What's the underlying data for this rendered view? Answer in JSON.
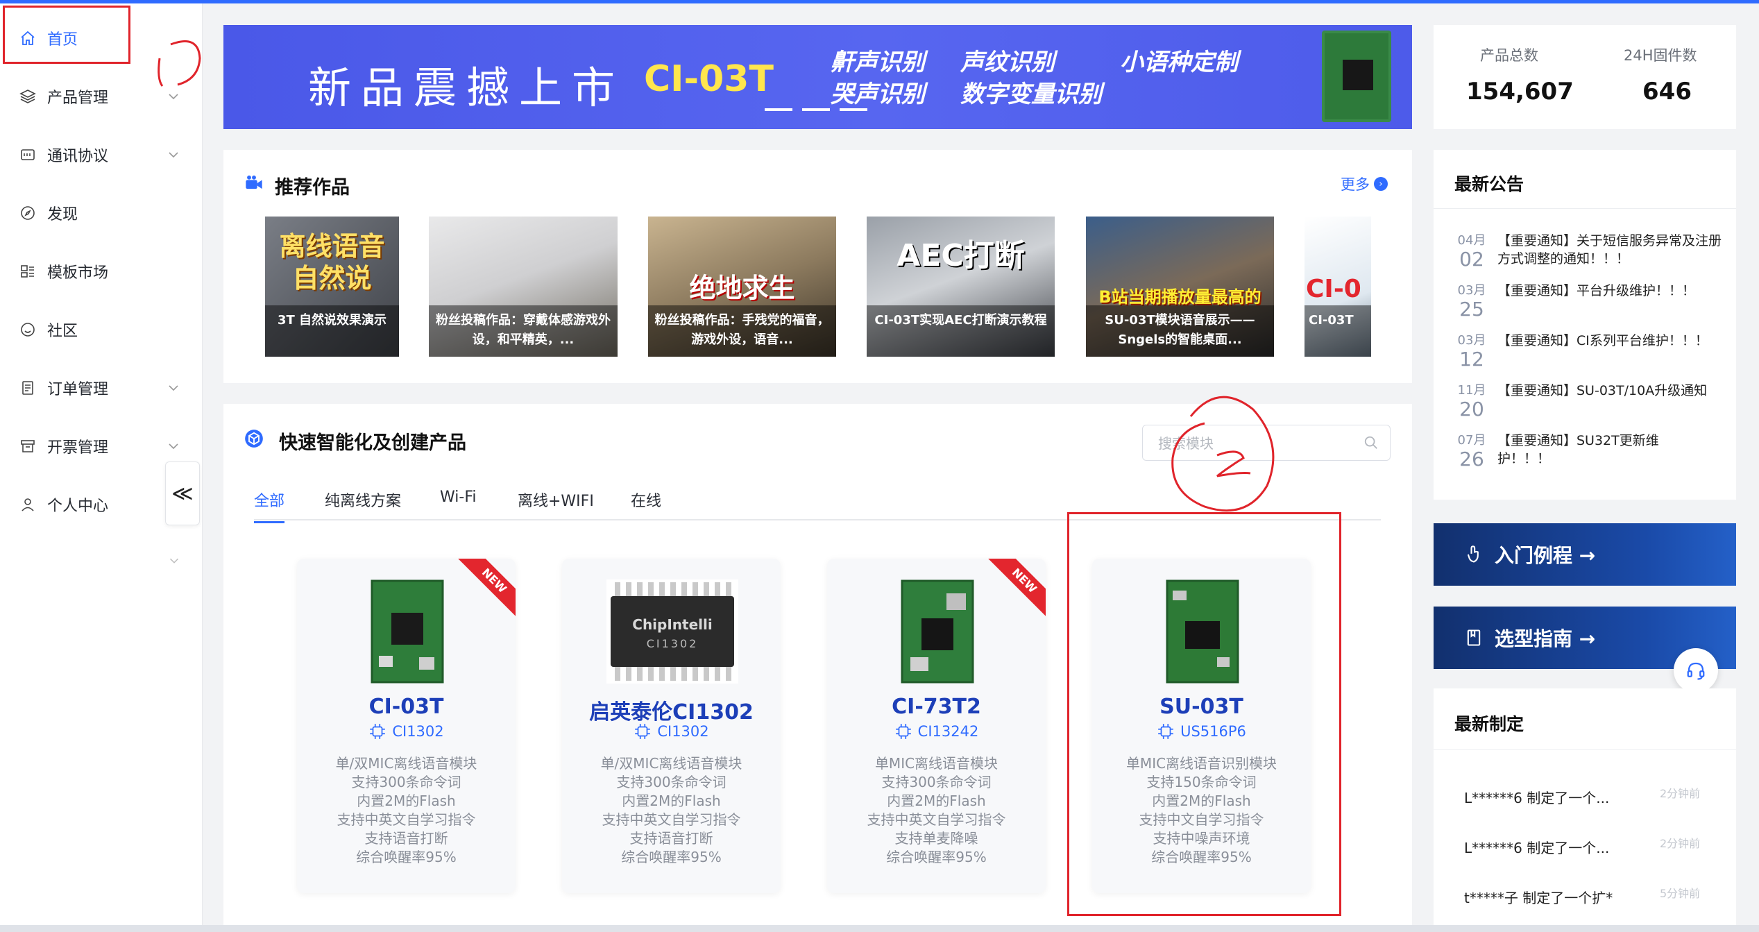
{
  "sidebar": {
    "items": [
      {
        "label": "首页",
        "icon": "home-icon",
        "active": true
      },
      {
        "label": "产品管理",
        "icon": "layers-icon"
      },
      {
        "label": "通讯协议",
        "icon": "protocol-icon"
      },
      {
        "label": "发现",
        "icon": "compass-icon"
      },
      {
        "label": "模板市场",
        "icon": "template-icon"
      },
      {
        "label": "社区",
        "icon": "smile-icon"
      },
      {
        "label": "订单管理",
        "icon": "order-icon"
      },
      {
        "label": "开票管理",
        "icon": "invoice-icon"
      },
      {
        "label": "个人中心",
        "icon": "user-icon"
      }
    ],
    "collapse_glyph": "≪"
  },
  "annotations": {
    "mark1": "1",
    "mark2": "2"
  },
  "banner": {
    "title": "新品震撼上市",
    "model": "CI-03T",
    "features": [
      "鼾声识别",
      "哭声识别",
      "声纹识别",
      "数字变量识别",
      "小语种定制"
    ]
  },
  "recommended": {
    "title": "推荐作品",
    "more": "更多",
    "works": [
      {
        "big": "离线语音\n自然说",
        "caption": "3T 自然说效果演示"
      },
      {
        "big": "",
        "caption": "粉丝投稿作品：穿戴体感游戏外设，和平精英，..."
      },
      {
        "big": "绝地求生",
        "caption": "粉丝投稿作品：手残党的福音，游戏外设，语音..."
      },
      {
        "big": "AEC打断",
        "caption": "CI-03T实现AEC打断演示教程"
      },
      {
        "big": "B站当期播放量最高的",
        "caption": "SU-03T模块语音展示——Sngels的智能桌面..."
      },
      {
        "big": "CI-0",
        "caption": "CI-03T"
      }
    ]
  },
  "quick": {
    "title": "快速智能化及创建产品",
    "search_placeholder": "搜索模块",
    "tabs": [
      "全部",
      "纯离线方案",
      "Wi-Fi",
      "离线+WIFI",
      "在线"
    ],
    "products": [
      {
        "name": "CI-03T",
        "chip": "CI1302",
        "new": true,
        "new_label": "NEW",
        "desc": [
          "单/双MIC离线语音模块",
          "支持300条命令词",
          "内置2M的Flash",
          "支持中英文自学习指令",
          "支持语音打断",
          "综合唤醒率95%"
        ]
      },
      {
        "name": "启英泰伦CI1302",
        "chip": "CI1302",
        "new": false,
        "chip_brand": "ChipIntelli",
        "chip_model": "CI1302",
        "desc": [
          "单/双MIC离线语音模块",
          "支持300条命令词",
          "内置2M的Flash",
          "支持中英文自学习指令",
          "支持语音打断",
          "综合唤醒率95%"
        ]
      },
      {
        "name": "CI-73T2",
        "chip": "CI13242",
        "new": true,
        "new_label": "NEW",
        "desc": [
          "单MIC离线语音模块",
          "支持300条命令词",
          "内置2M的Flash",
          "支持中英文自学习指令",
          "支持单麦降噪",
          "综合唤醒率95%"
        ]
      },
      {
        "name": "SU-03T",
        "chip": "US516P6",
        "new": false,
        "desc": [
          "单MIC离线语音识别模块",
          "支持150条命令词",
          "内置2M的Flash",
          "支持中文自学习指令",
          "支持中噪声环境",
          "综合唤醒率95%"
        ]
      }
    ]
  },
  "stats": {
    "total_label": "产品总数",
    "total_value": "154,607",
    "firmware_label": "24H固件数",
    "firmware_value": "646"
  },
  "notices": {
    "title": "最新公告",
    "items": [
      {
        "month": "04月",
        "day": "02",
        "text": "【重要通知】关于短信服务异常及注册方式调整的通知！！！"
      },
      {
        "month": "03月",
        "day": "25",
        "text": "【重要通知】平台升级维护！！！"
      },
      {
        "month": "03月",
        "day": "12",
        "text": "【重要通知】CI系列平台维护！！！"
      },
      {
        "month": "11月",
        "day": "20",
        "text": "【重要通知】SU-03T/10A升级通知"
      },
      {
        "month": "07月",
        "day": "26",
        "text": "【重要通知】SU32T更新维护！！！"
      }
    ]
  },
  "cta": {
    "tutorial": "入门例程 →",
    "guide": "选型指南 →"
  },
  "recent": {
    "title": "最新制定",
    "items": [
      {
        "text": "L******6 制定了一个...",
        "time": "2分钟前"
      },
      {
        "text": "L******6 制定了一个...",
        "time": "2分钟前"
      },
      {
        "text": "t*****子 制定了一个扩*",
        "time": "5分钟前"
      }
    ]
  },
  "colors": {
    "accent": "#2f6bff",
    "highlight": "#e0242b"
  }
}
